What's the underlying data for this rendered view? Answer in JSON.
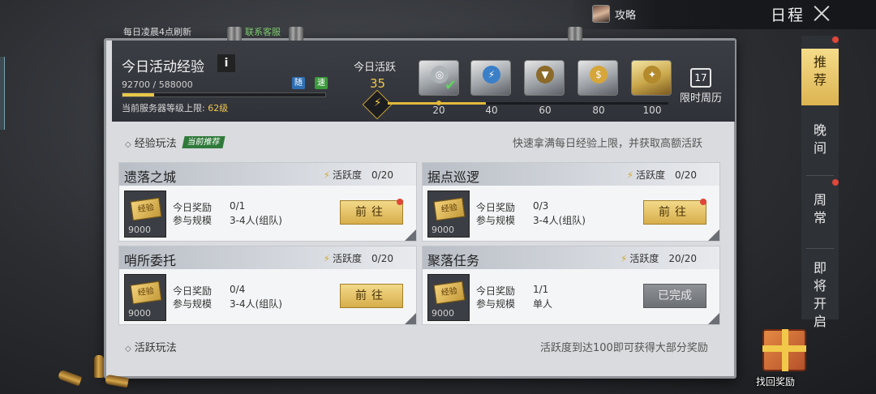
{
  "top": {
    "strategy_label": "攻略",
    "title": "日程"
  },
  "refresh_note": "每日凌晨4点刷新",
  "customer_service": "联系客服",
  "exp": {
    "title": "今日活动经验",
    "info": "i",
    "current": "92700",
    "max": "588000",
    "progress_fraction": 0.157,
    "boost_a": "随",
    "boost_b": "速",
    "level_prefix": "当前服务器等级上限: ",
    "level": "62级"
  },
  "activity": {
    "label": "今日活跃",
    "value": "35",
    "progress_fraction": 0.35,
    "milestones": [
      "20",
      "40",
      "60",
      "80",
      "100"
    ],
    "weekly_label": "限时周历",
    "weekly_icon_day": "17"
  },
  "section_exp": {
    "title": "经验玩法",
    "tag": "当前推荐",
    "desc": "快速拿满每日经验上限，并获取高额活跃"
  },
  "cards": [
    {
      "name": "遗落之城",
      "act_label": "活跃度",
      "act_value": "0/20",
      "reward_label": "今日奖励",
      "reward_value": "0/1",
      "scale_label": "参与规模",
      "scale_value": "3-4人(组队)",
      "ticket_label": "经验",
      "ticket_value": "9000",
      "button": "前往",
      "completed": false
    },
    {
      "name": "据点巡逻",
      "act_label": "活跃度",
      "act_value": "0/20",
      "reward_label": "今日奖励",
      "reward_value": "0/3",
      "scale_label": "参与规模",
      "scale_value": "3-4人(组队)",
      "ticket_label": "经验",
      "ticket_value": "9000",
      "button": "前往",
      "completed": false
    },
    {
      "name": "哨所委托",
      "act_label": "活跃度",
      "act_value": "0/20",
      "reward_label": "今日奖励",
      "reward_value": "0/4",
      "scale_label": "参与规模",
      "scale_value": "3-4人(组队)",
      "ticket_label": "经验",
      "ticket_value": "9000",
      "button": "前往",
      "completed": false
    },
    {
      "name": "聚落任务",
      "act_label": "活跃度",
      "act_value": "20/20",
      "reward_label": "今日奖励",
      "reward_value": "1/1",
      "scale_label": "参与规模",
      "scale_value": "单人",
      "ticket_label": "经验",
      "ticket_value": "9000",
      "button": "已完成",
      "completed": true
    }
  ],
  "section_active": {
    "title": "活跃玩法",
    "desc": "活跃度到达100即可获得大部分奖励"
  },
  "side_tabs": [
    {
      "label": "推荐",
      "active": true
    },
    {
      "label": "晚间",
      "active": false
    },
    {
      "label": "周常",
      "active": false
    },
    {
      "label": "即将开启",
      "active": false
    }
  ],
  "reward": {
    "label": "找回奖励"
  },
  "colors": {
    "accent_gold": "#e2b93c",
    "recommend_green": "#2f7a3a",
    "alert_red": "#e0463a"
  }
}
